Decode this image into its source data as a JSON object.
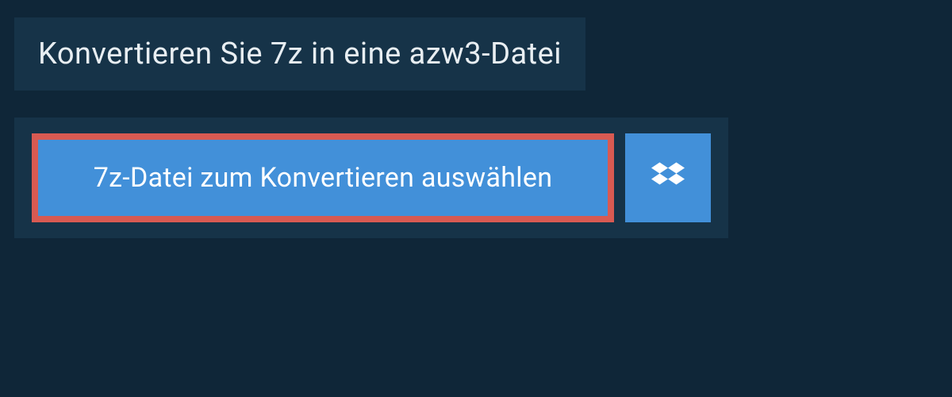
{
  "header": {
    "title": "Konvertieren Sie 7z in eine azw3-Datei"
  },
  "actions": {
    "select_file_label": "7z-Datei zum Konvertieren auswählen"
  },
  "colors": {
    "accent": "#4290d9",
    "highlight_border": "#d85a52",
    "panel": "#163348",
    "background": "#0f2638"
  }
}
